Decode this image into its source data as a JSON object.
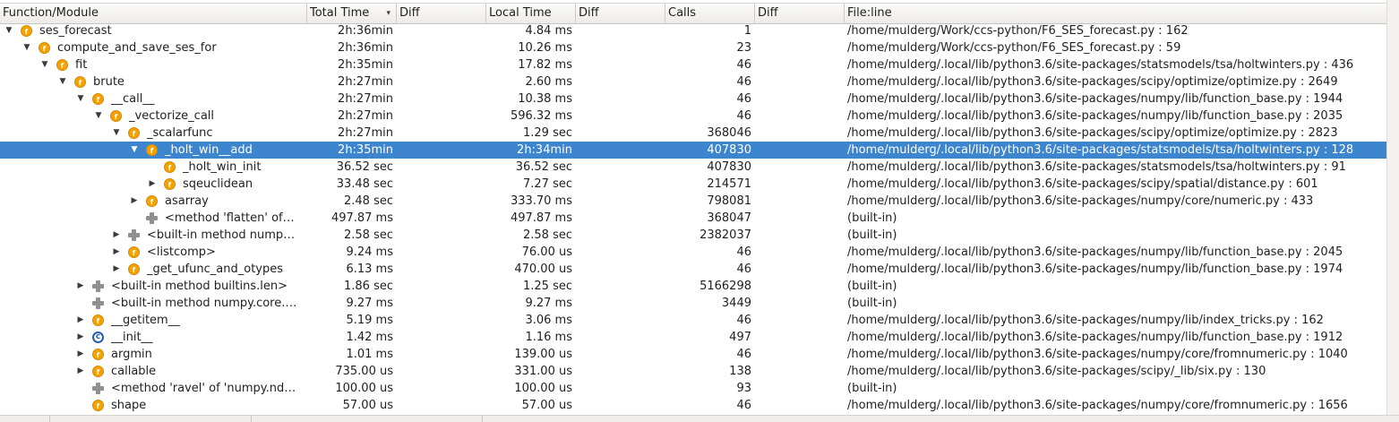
{
  "headers": {
    "function": "Function/Module",
    "total_time": "Total Time",
    "diff1": "Diff",
    "local_time": "Local Time",
    "diff2": "Diff",
    "calls": "Calls",
    "diff3": "Diff",
    "fileline": "File:line",
    "sort_indicator": "▾"
  },
  "selected_row": 7,
  "rows": [
    {
      "indent": 0,
      "toggle": "expanded",
      "icon": "function",
      "name": "ses_forecast",
      "total": "2h:36min",
      "local": "4.84 ms",
      "calls": "1",
      "file": "/home/mulderg/Work/ccs-python/F6_SES_forecast.py : 162"
    },
    {
      "indent": 1,
      "toggle": "expanded",
      "icon": "function",
      "name": "compute_and_save_ses_for",
      "total": "2h:36min",
      "local": "10.26 ms",
      "calls": "23",
      "file": "/home/mulderg/Work/ccs-python/F6_SES_forecast.py : 59"
    },
    {
      "indent": 2,
      "toggle": "expanded",
      "icon": "function",
      "name": "fit",
      "total": "2h:35min",
      "local": "17.82 ms",
      "calls": "46",
      "file": "/home/mulderg/.local/lib/python3.6/site-packages/statsmodels/tsa/holtwinters.py : 436"
    },
    {
      "indent": 3,
      "toggle": "expanded",
      "icon": "function",
      "name": "brute",
      "total": "2h:27min",
      "local": "2.60 ms",
      "calls": "46",
      "file": "/home/mulderg/.local/lib/python3.6/site-packages/scipy/optimize/optimize.py : 2649"
    },
    {
      "indent": 4,
      "toggle": "expanded",
      "icon": "function",
      "name": "__call__",
      "total": "2h:27min",
      "local": "10.38 ms",
      "calls": "46",
      "file": "/home/mulderg/.local/lib/python3.6/site-packages/numpy/lib/function_base.py : 1944"
    },
    {
      "indent": 5,
      "toggle": "expanded",
      "icon": "function",
      "name": "_vectorize_call",
      "total": "2h:27min",
      "local": "596.32 ms",
      "calls": "46",
      "file": "/home/mulderg/.local/lib/python3.6/site-packages/numpy/lib/function_base.py : 2035"
    },
    {
      "indent": 6,
      "toggle": "expanded",
      "icon": "function",
      "name": "_scalarfunc",
      "total": "2h:27min",
      "local": "1.29 sec",
      "calls": "368046",
      "file": "/home/mulderg/.local/lib/python3.6/site-packages/scipy/optimize/optimize.py : 2823"
    },
    {
      "indent": 7,
      "toggle": "expanded",
      "icon": "function",
      "name": "_holt_win__add",
      "total": "2h:35min",
      "local": "2h:34min",
      "calls": "407830",
      "file": "/home/mulderg/.local/lib/python3.6/site-packages/statsmodels/tsa/holtwinters.py : 128"
    },
    {
      "indent": 8,
      "toggle": "none",
      "icon": "function",
      "name": "_holt_win_init",
      "total": "36.52 sec",
      "local": "36.52 sec",
      "calls": "407830",
      "file": "/home/mulderg/.local/lib/python3.6/site-packages/statsmodels/tsa/holtwinters.py : 91"
    },
    {
      "indent": 8,
      "toggle": "collapsed",
      "icon": "function",
      "name": "sqeuclidean",
      "total": "33.48 sec",
      "local": "7.27 sec",
      "calls": "214571",
      "file": "/home/mulderg/.local/lib/python3.6/site-packages/scipy/spatial/distance.py : 601"
    },
    {
      "indent": 7,
      "toggle": "collapsed",
      "icon": "function",
      "name": "asarray",
      "total": "2.48 sec",
      "local": "333.70 ms",
      "calls": "798081",
      "file": "/home/mulderg/.local/lib/python3.6/site-packages/numpy/core/numeric.py : 433"
    },
    {
      "indent": 7,
      "toggle": "none",
      "icon": "builtin",
      "name": "<method 'flatten' of…",
      "total": "497.87 ms",
      "local": "497.87 ms",
      "calls": "368047",
      "file": "(built-in)"
    },
    {
      "indent": 6,
      "toggle": "collapsed",
      "icon": "builtin",
      "name": "<built-in method nump…",
      "total": "2.58 sec",
      "local": "2.58 sec",
      "calls": "2382037",
      "file": "(built-in)"
    },
    {
      "indent": 6,
      "toggle": "collapsed",
      "icon": "function",
      "name": "<listcomp>",
      "total": "9.24 ms",
      "local": "76.00 us",
      "calls": "46",
      "file": "/home/mulderg/.local/lib/python3.6/site-packages/numpy/lib/function_base.py : 2045"
    },
    {
      "indent": 6,
      "toggle": "collapsed",
      "icon": "function",
      "name": "_get_ufunc_and_otypes",
      "total": "6.13 ms",
      "local": "470.00 us",
      "calls": "46",
      "file": "/home/mulderg/.local/lib/python3.6/site-packages/numpy/lib/function_base.py : 1974"
    },
    {
      "indent": 4,
      "toggle": "collapsed",
      "icon": "builtin",
      "name": "<built-in method builtins.len>",
      "total": "1.86 sec",
      "local": "1.25 sec",
      "calls": "5166298",
      "file": "(built-in)"
    },
    {
      "indent": 4,
      "toggle": "none",
      "icon": "builtin",
      "name": "<built-in method numpy.core.…",
      "total": "9.27 ms",
      "local": "9.27 ms",
      "calls": "3449",
      "file": "(built-in)"
    },
    {
      "indent": 4,
      "toggle": "collapsed",
      "icon": "function",
      "name": "__getitem__",
      "total": "5.19 ms",
      "local": "3.06 ms",
      "calls": "46",
      "file": "/home/mulderg/.local/lib/python3.6/site-packages/numpy/lib/index_tricks.py : 162"
    },
    {
      "indent": 4,
      "toggle": "collapsed",
      "icon": "class",
      "name": "__init__",
      "total": "1.42 ms",
      "local": "1.16 ms",
      "calls": "497",
      "file": "/home/mulderg/.local/lib/python3.6/site-packages/numpy/lib/function_base.py : 1912"
    },
    {
      "indent": 4,
      "toggle": "collapsed",
      "icon": "function",
      "name": "argmin",
      "total": "1.01 ms",
      "local": "139.00 us",
      "calls": "46",
      "file": "/home/mulderg/.local/lib/python3.6/site-packages/numpy/core/fromnumeric.py : 1040"
    },
    {
      "indent": 4,
      "toggle": "collapsed",
      "icon": "function",
      "name": "callable",
      "total": "735.00 us",
      "local": "331.00 us",
      "calls": "138",
      "file": "/home/mulderg/.local/lib/python3.6/site-packages/scipy/_lib/six.py : 130"
    },
    {
      "indent": 4,
      "toggle": "none",
      "icon": "builtin",
      "name": "<method 'ravel' of 'numpy.nd…",
      "total": "100.00 us",
      "local": "100.00 us",
      "calls": "93",
      "file": "(built-in)"
    },
    {
      "indent": 4,
      "toggle": "none",
      "icon": "function",
      "name": "shape",
      "total": "57.00 us",
      "local": "57.00 us",
      "calls": "46",
      "file": "/home/mulderg/.local/lib/python3.6/site-packages/numpy/core/fromnumeric.py : 1656"
    }
  ]
}
